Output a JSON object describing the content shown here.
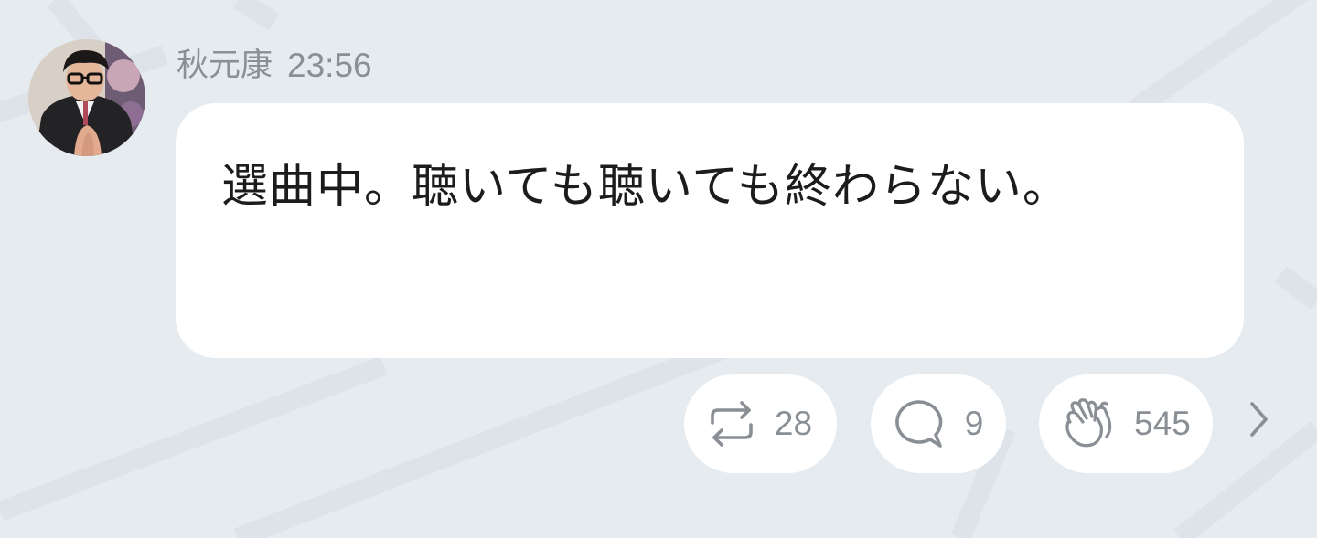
{
  "post": {
    "author": "秋元康",
    "time": "23:56",
    "message": "選曲中。聴いても聴いても終わらない。"
  },
  "actions": {
    "repost": {
      "icon": "repost-icon",
      "count": "28"
    },
    "comment": {
      "icon": "comment-icon",
      "count": "9"
    },
    "clap": {
      "icon": "clap-icon",
      "count": "545"
    },
    "more": {
      "icon": "chevron-right-icon"
    }
  },
  "colors": {
    "background": "#e6ebf0",
    "bubble": "#ffffff",
    "message_text": "#1c1c1c",
    "meta_text": "#8a8f96",
    "icon": "#8a8f96"
  }
}
